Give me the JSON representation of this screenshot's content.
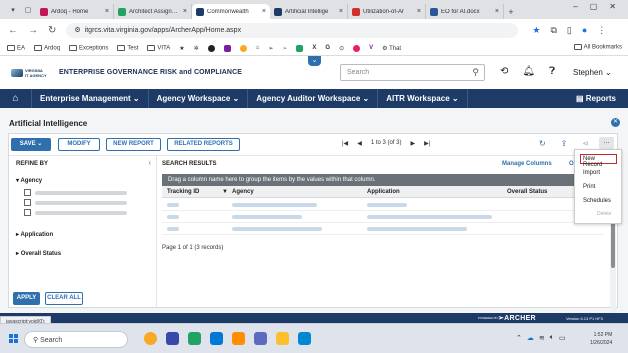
{
  "browser": {
    "tabs": [
      {
        "label": "Ardoq - Home",
        "color": "#c2185b"
      },
      {
        "label": "Architect Assignme",
        "color": "#21a366"
      },
      {
        "label": "Commonwealth",
        "color": "#1d3b66",
        "active": true
      },
      {
        "label": "Artificial Intellige",
        "color": "#1d3b66"
      },
      {
        "label": "Utilization-of-Ar",
        "color": "#d32f2f"
      },
      {
        "label": "EO for AI.docx",
        "color": "#2b579a"
      }
    ],
    "url": "itgrcs.vita.virginia.gov/apps/ArcherApp/Home.aspx",
    "bookmarks": [
      "EA",
      "Ardoq",
      "Exceptions",
      "Test",
      "VITA",
      "That"
    ],
    "all_bookmarks": "All Bookmarks"
  },
  "app": {
    "logo_line1": "VIRGINIA",
    "logo_line2": "IT AGENCY",
    "title": "ENTERPRISE GOVERNANCE RISK and COMPLIANCE",
    "search_placeholder": "Search",
    "user": "Stephen"
  },
  "nav": {
    "items": [
      "Enterprise Management",
      "Agency Workspace",
      "Agency Auditor Workspace",
      "AITR Workspace"
    ],
    "reports": "Reports"
  },
  "page": {
    "title": "Artificial Intelligence",
    "toolbar": {
      "save": "SAVE",
      "modify": "MODIFY",
      "new_report": "NEW REPORT",
      "related_reports": "RELATED REPORTS",
      "pager": "1 to 3 (of 3)"
    },
    "refine": {
      "title": "REFINE BY",
      "facets": [
        "Agency",
        "Application",
        "Overall Status"
      ],
      "apply": "APPLY",
      "clear": "CLEAR ALL"
    },
    "results": {
      "title": "SEARCH RESULTS",
      "manage_columns": "Manage Columns",
      "options_partial": "Op",
      "group_hint": "Drag a column name here to group the items by the values within that column.",
      "columns": [
        "Tracking ID",
        "Agency",
        "Application",
        "Overall Status"
      ],
      "page_info": "Page 1 of 1 (3 records)"
    },
    "menu": {
      "items": [
        "New Record",
        "Import",
        "Print",
        "Schedules",
        "Delete"
      ]
    }
  },
  "status_url": "javascript:void(0);",
  "archer": {
    "powered": "POWERED BY",
    "brand": "ARCHER",
    "version": "Version 6.13 P1 HF3"
  },
  "taskbar": {
    "search": "Search",
    "time": "1:52 PM",
    "date": "1/26/2024"
  }
}
